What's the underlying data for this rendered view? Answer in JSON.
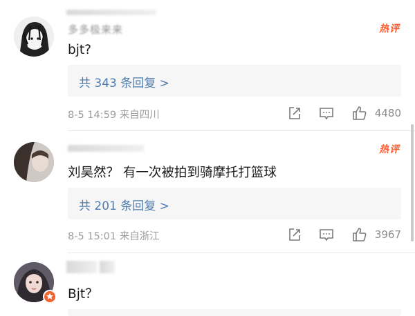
{
  "comments": [
    {
      "user_name": "多多极来来",
      "hot_badge": "热评",
      "text": "bjt?",
      "reply_link": "共 343 条回复 >",
      "meta": "8-5 14:59  来自四川",
      "likes": "4480",
      "colors": {
        "avatar_bg": "#e9e9e9",
        "avatar_hair": "#1e1e1e"
      }
    },
    {
      "user_name": "",
      "hot_badge": "热评",
      "text": "刘昊然？ 有一次被拍到骑摩托打篮球",
      "reply_link": "共 201 条回复 >",
      "meta": "8-5 15:01  来自浙江",
      "likes": "3967",
      "colors": {
        "avatar_bg": "#c9c4c1",
        "avatar_hair": "#3b302b"
      }
    },
    {
      "user_name": "",
      "text": "Bjt？",
      "colors": {
        "avatar_bg": "#6e6a73",
        "badge": "#f2622e"
      }
    }
  ],
  "icons": [
    "share-icon",
    "comment-icon",
    "like-icon",
    "hot-badge",
    "verified-badge"
  ],
  "colors": {
    "link": "#4f7cae",
    "hot": "#ff5b2e",
    "meta": "#9c9c9c",
    "reply_bg": "#f6f6f6"
  }
}
